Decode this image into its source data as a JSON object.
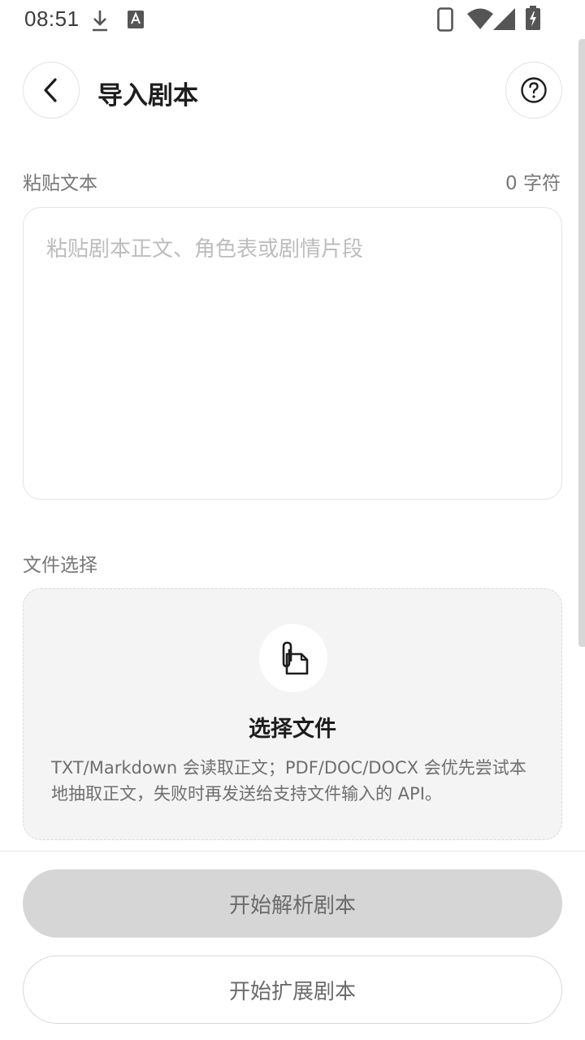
{
  "status_bar": {
    "time": "08:51",
    "icons": [
      "download-icon",
      "keyboard-a-icon",
      "phone-icon",
      "wifi-icon",
      "signal-icon",
      "battery-charging-icon"
    ]
  },
  "header": {
    "back_icon": "chevron-left-icon",
    "title": "导入剧本",
    "help_icon": "question-circle-icon"
  },
  "paste": {
    "label": "粘贴文本",
    "count": "0 字符",
    "placeholder": "粘贴剧本正文、角色表或剧情片段"
  },
  "file": {
    "label": "文件选择",
    "icon": "attachment-file-icon",
    "title": "选择文件",
    "desc": "TXT/Markdown 会读取正文；PDF/DOC/DOCX 会优先尝试本地抽取正文，失败时再发送给支持文件输入的 API。"
  },
  "actions": {
    "parse_label": "开始解析剧本",
    "expand_label": "开始扩展剧本"
  }
}
